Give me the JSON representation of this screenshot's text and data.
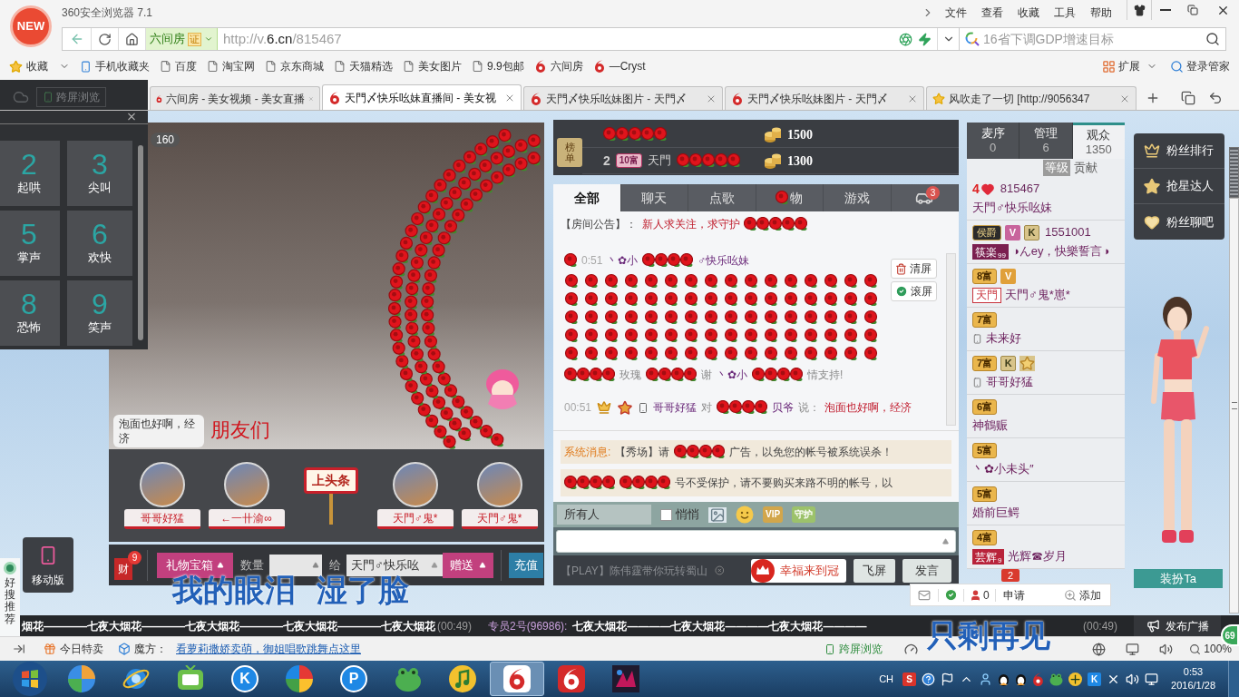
{
  "browser": {
    "logo": "NEW",
    "title": "360安全浏览器 7.1",
    "menu": [
      "文件",
      "查看",
      "收藏",
      "工具",
      "帮助"
    ],
    "address": {
      "site": "六间房",
      "cert": "证",
      "url_scheme": "http://v.",
      "url_host": "6.cn",
      "url_path": "/815467"
    },
    "search": {
      "placeholder": "16省下调GDP增速目标"
    },
    "bookmarks": [
      {
        "label": "收藏",
        "kind": "star"
      },
      {
        "label": "手机收藏夹",
        "kind": "phone"
      },
      {
        "label": "百度",
        "kind": "page"
      },
      {
        "label": "淘宝网",
        "kind": "page"
      },
      {
        "label": "京东商城",
        "kind": "page"
      },
      {
        "label": "天猫精选",
        "kind": "page"
      },
      {
        "label": "美女图片",
        "kind": "page"
      },
      {
        "label": "9.9包邮",
        "kind": "page"
      },
      {
        "label": "六间房",
        "kind": "six"
      },
      {
        "label": "—Cryst",
        "kind": "six"
      }
    ],
    "extensions": [
      {
        "label": "扩展",
        "kind": "grid"
      },
      {
        "label": "登录管家",
        "kind": "magnifier"
      }
    ],
    "cross_screen": "跨屏浏览",
    "tabs": [
      {
        "title": "六间房 - 美女视频 - 美女直播",
        "kind": "six",
        "selected": false
      },
      {
        "title": "天門〆快乐吆妹直播间 - 美女视",
        "kind": "six",
        "selected": true
      },
      {
        "title": "天門〆快乐吆妹图片 - 天門〆",
        "kind": "six",
        "selected": false
      },
      {
        "title": "天門〆快乐吆妹图片 - 天門〆",
        "kind": "six",
        "selected": false
      },
      {
        "title": "风吹走了一切 [http://9056347",
        "kind": "star",
        "selected": false
      }
    ]
  },
  "sound_panel": {
    "keys": [
      {
        "digit": "2",
        "label": "起哄"
      },
      {
        "digit": "3",
        "label": "尖叫"
      },
      {
        "digit": "5",
        "label": "掌声"
      },
      {
        "digit": "6",
        "label": "欢快"
      },
      {
        "digit": "8",
        "label": "恐怖"
      },
      {
        "digit": "9",
        "label": "笑声"
      }
    ]
  },
  "video": {
    "viewers": "160",
    "bubble": "泡面也好啊，经济",
    "caption": "朋友们",
    "rose_effect": true
  },
  "gift_wall": [
    {
      "name": "哥哥好猛",
      "kind": "avatar"
    },
    {
      "name": "←一卄渝∞",
      "kind": "avatar"
    },
    {
      "name": "上头条",
      "kind": "sign"
    },
    {
      "name": "天門♂鬼*",
      "kind": "avatar"
    },
    {
      "name": "天門♂鬼*",
      "kind": "avatar"
    }
  ],
  "gift_bar": {
    "wealth": "财",
    "wealth_count": "9",
    "box": "礼物宝箱",
    "quantity_label": "数量",
    "to_label": "给",
    "recipient": "天門♂快乐吆",
    "send": "赠送",
    "recharge": "充值"
  },
  "mobile_version": "移动版",
  "recommend": "好搜推荐",
  "lyrics": [
    "我的眼泪 湿了脸",
    "只剩再见"
  ],
  "ranking": {
    "tag": "榜单",
    "rows": [
      {
        "score": "1500",
        "covered": true
      },
      {
        "rank": "2",
        "badge": "10富",
        "name": "天門",
        "score": "1300",
        "covered": true
      }
    ]
  },
  "chat": {
    "tabs": [
      {
        "label": "全部",
        "kind": "text",
        "covered": false,
        "selected": true
      },
      {
        "label": "聊天",
        "kind": "text",
        "covered": false,
        "selected": false
      },
      {
        "label": "点歌",
        "kind": "text",
        "covered": false,
        "selected": false
      },
      {
        "label": "物",
        "kind": "text",
        "covered": true,
        "selected": false
      },
      {
        "label": "游戏",
        "kind": "text",
        "covered": false,
        "selected": false
      },
      {
        "kind": "car",
        "badge": "3",
        "covered": false,
        "selected": false
      }
    ],
    "announcement": {
      "label": "【房间公告】：",
      "text": "新人求关注，求守护",
      "covered": true
    },
    "tools": [
      {
        "label": "清屏",
        "kind": "trash"
      },
      {
        "label": "滚屏",
        "kind": "check"
      }
    ],
    "rose_effect": true,
    "messages": [
      {
        "parts": [
          {
            "kind": "rose"
          },
          {
            "kind": "time",
            "text": "0:51"
          },
          {
            "kind": "name",
            "text": "丶✿小"
          },
          {
            "kind": "roses"
          },
          {
            "kind": "name",
            "text": "♂快乐吆妹"
          }
        ]
      },
      {
        "parts": [
          {
            "kind": "roses"
          },
          {
            "kind": "plain",
            "text": "玫瑰"
          },
          {
            "kind": "roses"
          },
          {
            "kind": "plain",
            "text": "谢"
          },
          {
            "kind": "name",
            "text": "丶✿小"
          },
          {
            "kind": "roses"
          },
          {
            "kind": "plain",
            "text": "情支持!"
          }
        ]
      },
      {
        "parts": [
          {
            "kind": "time",
            "text": "00:51"
          },
          {
            "kind": "crown"
          },
          {
            "kind": "star"
          },
          {
            "kind": "phone"
          },
          {
            "kind": "name",
            "text": "哥哥好猛"
          },
          {
            "kind": "plain",
            "text": "对"
          },
          {
            "kind": "roses"
          },
          {
            "kind": "name",
            "text": "贝爷"
          },
          {
            "kind": "plain",
            "text": "说："
          },
          {
            "kind": "said",
            "text": "泡面也好啊，经济"
          }
        ]
      }
    ],
    "system": [
      {
        "parts": [
          {
            "kind": "label",
            "text": "系统消息:"
          },
          {
            "kind": "notice",
            "text": "【秀场】请"
          },
          {
            "kind": "roses"
          },
          {
            "kind": "notice",
            "text": "广告，以免您的帐号被系统误杀！"
          }
        ]
      },
      {
        "parts": [
          {
            "kind": "roses"
          },
          {
            "kind": "roses"
          },
          {
            "kind": "notice",
            "text": "号不受保护，请不要购买来路不明的帐号，以"
          }
        ]
      }
    ],
    "target": "所有人",
    "whisper": {
      "label": "悄悄",
      "checked": false
    },
    "toolbar": [
      {
        "kind": "image"
      },
      {
        "kind": "smile"
      },
      {
        "kind": "tile",
        "text": "VIP",
        "color": "#d2a64b"
      },
      {
        "kind": "tile",
        "text": "守护",
        "color": "#9cc26b"
      }
    ],
    "promo": "【PLAY】陈伟霆带你玩转蜀山",
    "crown_button": "幸福来到冠",
    "fly": "飞屏",
    "send": "发言"
  },
  "audience": {
    "tabs": [
      {
        "label": "麦序",
        "count": "0",
        "selected": false
      },
      {
        "label": "管理",
        "count": "6",
        "selected": false
      },
      {
        "label": "观众",
        "count": "1350",
        "selected": true
      }
    ],
    "sort": [
      {
        "label": "等级",
        "selected": true
      },
      {
        "label": "贡献",
        "selected": false
      }
    ],
    "users": [
      {
        "badges": [
          {
            "kind": "hearts",
            "text": "4"
          }
        ],
        "number": "815467",
        "name": "天門♂快乐吆妹",
        "mobile": false
      },
      {
        "badges": [
          {
            "kind": "title",
            "text": "侯爵"
          },
          {
            "kind": "v",
            "text": "V",
            "color": "#c8649c"
          },
          {
            "kind": "k",
            "text": "K"
          }
        ],
        "number": "1551001",
        "tag": {
          "text": "筷楽",
          "sub": "99",
          "kind": "solid",
          "color": "#7a1f4f"
        },
        "name": "◑んey，快樂誓言◑",
        "mobile": false
      },
      {
        "badges": [
          {
            "kind": "wealth",
            "text": "8富"
          },
          {
            "kind": "v",
            "text": "V",
            "color": "#e0a03a"
          }
        ],
        "tag": {
          "text": "天門",
          "kind": "outline",
          "color": "#c8323c"
        },
        "name": "天門♂鬼*崽*",
        "mobile": false
      },
      {
        "badges": [
          {
            "kind": "wealth",
            "text": "7富"
          }
        ],
        "name": "未来好",
        "mobile": true
      },
      {
        "badges": [
          {
            "kind": "wealth",
            "text": "7富"
          },
          {
            "kind": "k",
            "text": "K"
          },
          {
            "kind": "star"
          }
        ],
        "name": "哥哥好猛",
        "mobile": true
      },
      {
        "badges": [
          {
            "kind": "wealth",
            "text": "6富"
          }
        ],
        "name": "神鶴赈",
        "mobile": false
      },
      {
        "badges": [
          {
            "kind": "wealth",
            "text": "5富"
          }
        ],
        "name": "丶✿小未头″",
        "mobile": false
      },
      {
        "badges": [
          {
            "kind": "wealth",
            "text": "5富"
          }
        ],
        "name": "婚前巨鳄",
        "mobile": false
      },
      {
        "badges": [
          {
            "kind": "wealth",
            "text": "4富"
          }
        ],
        "tag": {
          "text": "芸辉",
          "sub": "9",
          "kind": "solid",
          "color": "#b8233a"
        },
        "name": "光辉☎岁月",
        "mobile": false
      }
    ],
    "footer": {
      "badge": "2",
      "count": "0",
      "apply": "申请",
      "add": "添加"
    }
  },
  "fan_tools": [
    {
      "label": "粉丝排行",
      "kind": "crown"
    },
    {
      "label": "抢星达人",
      "kind": "star"
    },
    {
      "label": "粉丝聊吧",
      "kind": "heart"
    }
  ],
  "dress_up": "装扮Ta",
  "marquee": {
    "segments": [
      {
        "kind": "gift",
        "text": "烟花————七夜大烟花————七夜大烟花————七夜大烟花————七夜大烟花"
      },
      {
        "kind": "time",
        "text": "(00:49)"
      },
      {
        "kind": "sender",
        "text": "专员2号(96986):"
      },
      {
        "kind": "gift",
        "text": "七夜大烟花————七夜大烟花————七夜大烟花————"
      },
      {
        "kind": "spacer"
      },
      {
        "kind": "time",
        "text": "(00:49)"
      }
    ],
    "button": "发布广播",
    "badge": "69"
  },
  "status_bar": {
    "deals": "今日特卖",
    "cube": "魔方：",
    "link": "看萝莉撒娇卖萌，御姐唱歌跳舞点这里",
    "cross_screen": "跨屏浏览",
    "zoom": "100%"
  },
  "taskbar": {
    "apps": [
      {
        "kind": "ball",
        "selected": false
      },
      {
        "kind": "ie",
        "selected": false
      },
      {
        "kind": "tv",
        "selected": false
      },
      {
        "kind": "glyph",
        "glyph": "K",
        "selected": false
      },
      {
        "kind": "pinwheel",
        "selected": false
      },
      {
        "kind": "glyph",
        "glyph": "P",
        "selected": false
      },
      {
        "kind": "frog",
        "selected": false
      },
      {
        "kind": "note",
        "selected": false
      },
      {
        "kind": "six",
        "selected": true
      },
      {
        "kind": "six_tile",
        "selected": false
      },
      {
        "kind": "picture",
        "selected": false
      }
    ],
    "lang": "CH",
    "tray": [
      {
        "kind": "glyph",
        "glyph": "S",
        "color": "#d9342b"
      },
      {
        "kind": "help"
      },
      {
        "kind": "flag"
      },
      {
        "kind": "up"
      },
      {
        "kind": "person"
      },
      {
        "kind": "penguin"
      },
      {
        "kind": "penguin"
      },
      {
        "kind": "six"
      },
      {
        "kind": "frog"
      },
      {
        "kind": "plus"
      },
      {
        "kind": "glyph",
        "glyph": "K",
        "color": "#1e88e5"
      },
      {
        "kind": "close"
      },
      {
        "kind": "volume"
      },
      {
        "kind": "monitor"
      }
    ],
    "time": "0:53",
    "date": "2016/1/28"
  }
}
